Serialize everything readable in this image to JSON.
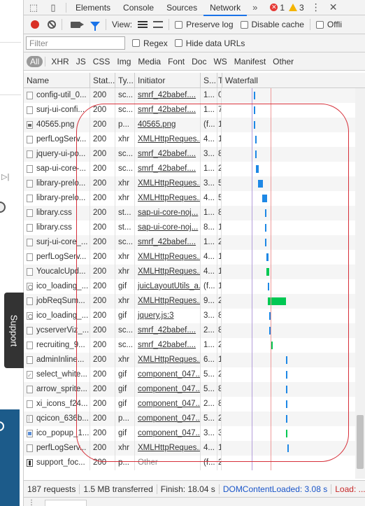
{
  "side": {
    "support_label": "Support"
  },
  "tabs": {
    "items": [
      {
        "label": "Elements"
      },
      {
        "label": "Console"
      },
      {
        "label": "Sources"
      },
      {
        "label": "Network"
      }
    ],
    "more": "»",
    "errors": "1",
    "warnings": "3"
  },
  "toolbar": {
    "view_label": "View:",
    "preserve_log": "Preserve log",
    "disable_cache": "Disable cache",
    "offline": "Offli"
  },
  "filter": {
    "placeholder": "Filter",
    "regex": "Regex",
    "hide_data_urls": "Hide data URLs"
  },
  "types": [
    "All",
    "XHR",
    "JS",
    "CSS",
    "Img",
    "Media",
    "Font",
    "Doc",
    "WS",
    "Manifest",
    "Other"
  ],
  "columns": {
    "name": "Name",
    "status": "Stat...",
    "type": "Ty...",
    "initiator": "Initiator",
    "size": "S...",
    "time": "T",
    "waterfall": "Waterfall"
  },
  "rows": [
    {
      "name": "config-util_0...",
      "status": "200",
      "type": "sc...",
      "initiator": "smrf_42babef....",
      "size": "1...",
      "time": "0",
      "icon": "doc"
    },
    {
      "name": "surj-ui-confi...",
      "status": "200",
      "type": "sc...",
      "initiator": "smrf_42babef....",
      "size": "1...",
      "time": "7",
      "icon": "doc"
    },
    {
      "name": "40565.png",
      "status": "200",
      "type": "p...",
      "initiator": "40565.png",
      "size": "(f...",
      "time": "1",
      "icon": "img"
    },
    {
      "name": "perfLogServ...",
      "status": "200",
      "type": "xhr",
      "initiator": "XMLHttpReques...",
      "size": "4...",
      "time": "1",
      "icon": "doc"
    },
    {
      "name": "jquery-ui-po...",
      "status": "200",
      "type": "sc...",
      "initiator": "smrf_42babef....",
      "size": "3...",
      "time": "8",
      "icon": "doc"
    },
    {
      "name": "sap-ui-core-...",
      "status": "200",
      "type": "sc...",
      "initiator": "smrf_42babef....",
      "size": "1...",
      "time": "2",
      "icon": "doc"
    },
    {
      "name": "library-prelo...",
      "status": "200",
      "type": "xhr",
      "initiator": "XMLHttpReques...",
      "size": "3...",
      "time": "5",
      "icon": "doc"
    },
    {
      "name": "library-prelo...",
      "status": "200",
      "type": "xhr",
      "initiator": "XMLHttpReques...",
      "size": "4...",
      "time": "5",
      "icon": "doc"
    },
    {
      "name": "library.css",
      "status": "200",
      "type": "st...",
      "initiator": "sap-ui-core-noj...",
      "size": "1...",
      "time": "8",
      "icon": "doc"
    },
    {
      "name": "library.css",
      "status": "200",
      "type": "st...",
      "initiator": "sap-ui-core-noj...",
      "size": "8...",
      "time": "1",
      "icon": "doc"
    },
    {
      "name": "surj-ui-core_...",
      "status": "200",
      "type": "sc...",
      "initiator": "smrf_42babef....",
      "size": "1...",
      "time": "2",
      "icon": "doc"
    },
    {
      "name": "perfLogServ...",
      "status": "200",
      "type": "xhr",
      "initiator": "XMLHttpReques...",
      "size": "4...",
      "time": "1",
      "icon": "doc"
    },
    {
      "name": "YoucalcUpd...",
      "status": "200",
      "type": "xhr",
      "initiator": "XMLHttpReques...",
      "size": "4...",
      "time": "1",
      "icon": "doc"
    },
    {
      "name": "ico_loading_...",
      "status": "200",
      "type": "gif",
      "initiator": "juicLayoutUtils_a...",
      "size": "(f...",
      "time": "1",
      "icon": "circ"
    },
    {
      "name": "jobReqSum...",
      "status": "200",
      "type": "xhr",
      "initiator": "XMLHttpReques...",
      "size": "9...",
      "time": "2",
      "icon": "doc"
    },
    {
      "name": "ico_loading_...",
      "status": "200",
      "type": "gif",
      "initiator": "jquery.js:3",
      "size": "3...",
      "time": "8",
      "icon": "circ"
    },
    {
      "name": "ycserverViz_...",
      "status": "200",
      "type": "sc...",
      "initiator": "smrf_42babef....",
      "size": "2...",
      "time": "8",
      "icon": "doc"
    },
    {
      "name": "recruiting_9...",
      "status": "200",
      "type": "sc...",
      "initiator": "smrf_42babef....",
      "size": "1...",
      "time": "2",
      "icon": "doc"
    },
    {
      "name": "adminInline...",
      "status": "200",
      "type": "xhr",
      "initiator": "XMLHttpReques...",
      "size": "6...",
      "time": "1",
      "icon": "doc"
    },
    {
      "name": "select_white...",
      "status": "200",
      "type": "gif",
      "initiator": "component_047...",
      "size": "5...",
      "time": "2",
      "icon": "check"
    },
    {
      "name": "arrow_sprite...",
      "status": "200",
      "type": "gif",
      "initiator": "component_047...",
      "size": "5...",
      "time": "8",
      "icon": "doc"
    },
    {
      "name": "xi_icons_f24...",
      "status": "200",
      "type": "gif",
      "initiator": "component_047...",
      "size": "2...",
      "time": "8",
      "icon": "doc"
    },
    {
      "name": "qcicon_636b...",
      "status": "200",
      "type": "p...",
      "initiator": "component_047...",
      "size": "5...",
      "time": "2",
      "icon": "grid"
    },
    {
      "name": "ico_popup_1...",
      "status": "200",
      "type": "gif",
      "initiator": "component_047...",
      "size": "3...",
      "time": "3",
      "icon": "blue"
    },
    {
      "name": "perfLogServ...",
      "status": "200",
      "type": "xhr",
      "initiator": "XMLHttpReques...",
      "size": "4...",
      "time": "1",
      "icon": "doc"
    },
    {
      "name": "support_foc...",
      "status": "200",
      "type": "p...",
      "initiator": "Other",
      "size": "(f...",
      "time": "2",
      "icon": "dark",
      "initiator_plain": true
    }
  ],
  "status_bar": {
    "requests": "187 requests",
    "transferred": "1.5 MB transferred",
    "finish": "Finish: 18.04 s",
    "dcl": "DOMContentLoaded: 3.08 s",
    "load": "Load: ..."
  },
  "colors": {
    "accent": "#1a73e8",
    "record": "#d93025",
    "annotation": "#d6303a",
    "waterfall_blue": "#1e88e5",
    "waterfall_green": "#00c853"
  }
}
